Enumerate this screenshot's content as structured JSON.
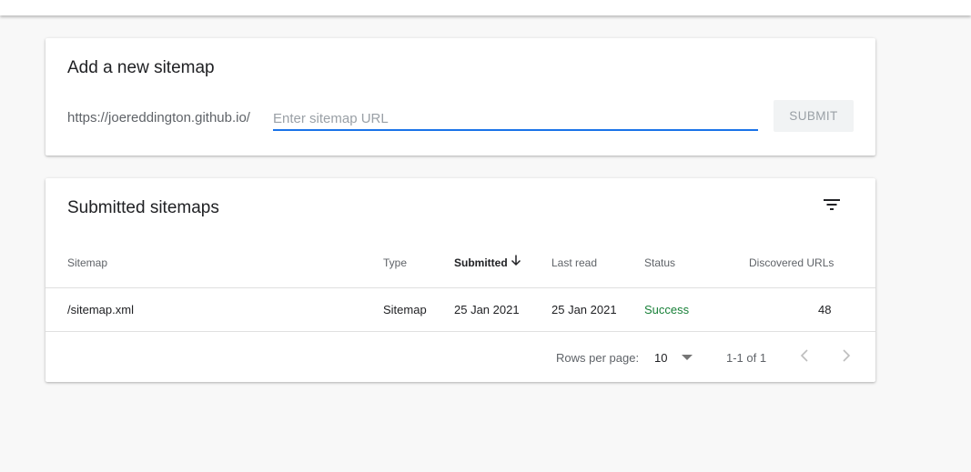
{
  "add_sitemap": {
    "title": "Add a new sitemap",
    "url_prefix": "https://joereddington.github.io/",
    "input_placeholder": "Enter sitemap URL",
    "input_value": "",
    "submit_label": "SUBMIT"
  },
  "submitted": {
    "title": "Submitted sitemaps",
    "columns": {
      "sitemap": "Sitemap",
      "type": "Type",
      "submitted": "Submitted",
      "last_read": "Last read",
      "status": "Status",
      "discovered_urls": "Discovered URLs"
    },
    "rows": [
      {
        "sitemap": "/sitemap.xml",
        "type": "Sitemap",
        "submitted": "25 Jan 2021",
        "last_read": "25 Jan 2021",
        "status": "Success",
        "discovered_urls": "48"
      }
    ],
    "sorted_column": "submitted",
    "sort_direction": "descending"
  },
  "pagination": {
    "rows_per_page_label": "Rows per page:",
    "rows_per_page_value": "10",
    "range_text": "1-1 of 1"
  },
  "colors": {
    "accent": "#1a73e8",
    "success": "#188038",
    "disabled_text": "#9aa0a6"
  },
  "icons": {
    "filter": "filter-icon",
    "sort": "arrow-down-icon",
    "dropdown": "triangle-down-icon",
    "prev": "chevron-left-icon",
    "next": "chevron-right-icon"
  }
}
